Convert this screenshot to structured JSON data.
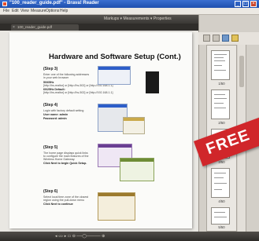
{
  "window": {
    "title": "\"100_reader_guide.pdf\" - Brava! Reader",
    "controls": {
      "minimize": "_",
      "maximize": "□",
      "close": "×"
    }
  },
  "menubar": [
    "File",
    "Edit",
    "View",
    "Measure",
    "Options",
    "Help"
  ],
  "toolbar": {
    "center_nav": "Markups ▾   Measurements ▾   Properties"
  },
  "tab": {
    "label": "100_reader_guide.pdf"
  },
  "page": {
    "heading": "Hardware and Software Setup (Cont.)",
    "steps": [
      {
        "title": "(Step 3)",
        "lines": [
          "Enter one of the following addresses",
          "in your web browser",
          "50/65Hz",
          "[http://hs-realtor] or [http://hs-502] or [http://192.168.1.1]",
          "60/25Hz Default:",
          "[http://hs-realtor] or [http://hs-502] or [http://192.168.1.1]"
        ]
      },
      {
        "title": "(Step 4)",
        "lines": [
          "Login with factory default setting",
          "User name: admin",
          "Password: admin"
        ]
      },
      {
        "title": "(Step 5)",
        "lines": [
          "The home page displays quick links",
          "to configure the main features of the",
          "Wireless Home Gateway.",
          "Click Next to begin Quick Setup."
        ]
      },
      {
        "title": "(Step 6)",
        "lines": [
          "Select local time zone of the closest",
          "region using the pull-down menu",
          "Click Next to continue"
        ]
      }
    ]
  },
  "thumbnails": [
    {
      "label": "1/50"
    },
    {
      "label": "2/50"
    },
    {
      "label": "3/50"
    },
    {
      "label": "4/50"
    },
    {
      "label": "5/50"
    }
  ],
  "statusbar": {
    "controls": "◂  ◃  ▹  ▸   ▭  ⊖ ──◯───── ⊕"
  },
  "banner": {
    "text": "FREE",
    "color": "#d0262a"
  }
}
